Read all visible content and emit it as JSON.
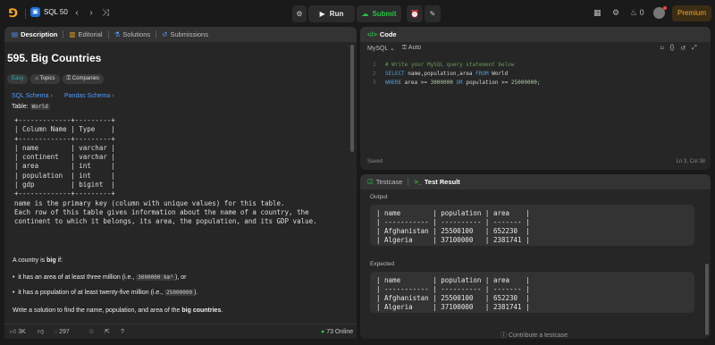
{
  "topbar": {
    "list_name": "SQL 50",
    "run": "Run",
    "submit": "Submit",
    "fire_count": "0",
    "premium": "Premium"
  },
  "description": {
    "tabs": [
      "Description",
      "Editorial",
      "Solutions",
      "Submissions"
    ],
    "title": "595. Big Countries",
    "tags": [
      "Easy",
      "Topics",
      "Companies"
    ],
    "schema_links": [
      "SQL Schema",
      "Pandas Schema"
    ],
    "table_label": "Table:",
    "table_name": "World",
    "ascii_table": "+-------------+---------+\n| Column Name | Type    |\n+-------------+---------+\n| name        | varchar |\n| continent   | varchar |\n| area        | int     |\n| population  | int     |\n| gdp         | bigint  |\n+-------------+---------+\nname is the primary key (column with unique values) for this table.\nEach row of this table gives information about the name of a country, the\ncontinent to which it belongs, its area, the population, and its GDP value.",
    "big_intro_pre": "A country is ",
    "big_intro_bold": "big",
    "big_intro_post": " if:",
    "bullet1_pre": "it has an area of at least three million (i.e., ",
    "bullet1_code": "3000000 km²",
    "bullet1_post": "), or",
    "bullet2_pre": "it has a population of at least twenty-five million (i.e., ",
    "bullet2_code": "25000000",
    "bullet2_post": ").",
    "task_pre": "Write a solution to find the name, population, and area of the ",
    "task_bold": "big countries",
    "task_post": ".",
    "likes": "3K",
    "comments": "297",
    "online": "73 Online"
  },
  "code": {
    "tab": "Code",
    "language": "MySQL",
    "autocomplete": "Auto",
    "line_numbers": [
      "1",
      "2",
      "3"
    ],
    "saved": "Saved",
    "cursor": "Ln 3, Col 38"
  },
  "result": {
    "tabs": [
      "Testcase",
      "Test Result"
    ],
    "output_label": "Output",
    "expected_label": "Expected",
    "output_table": "| name        | population | area    |\n| ----------- | ---------- | ------- |\n| Afghanistan | 25500100   | 652230  |\n| Algeria     | 37100000   | 2381741 |",
    "expected_table": "| name        | population | area    |\n| ----------- | ---------- | ------- |\n| Afghanistan | 25500100   | 652230  |\n| Algeria     | 37100000   | 2381741 |",
    "contribute": "Contribute a testcase"
  },
  "colors": {
    "accent": "#f5a623",
    "easy": "#1cbaba",
    "submit": "#28c244",
    "link": "#4e9bff"
  }
}
